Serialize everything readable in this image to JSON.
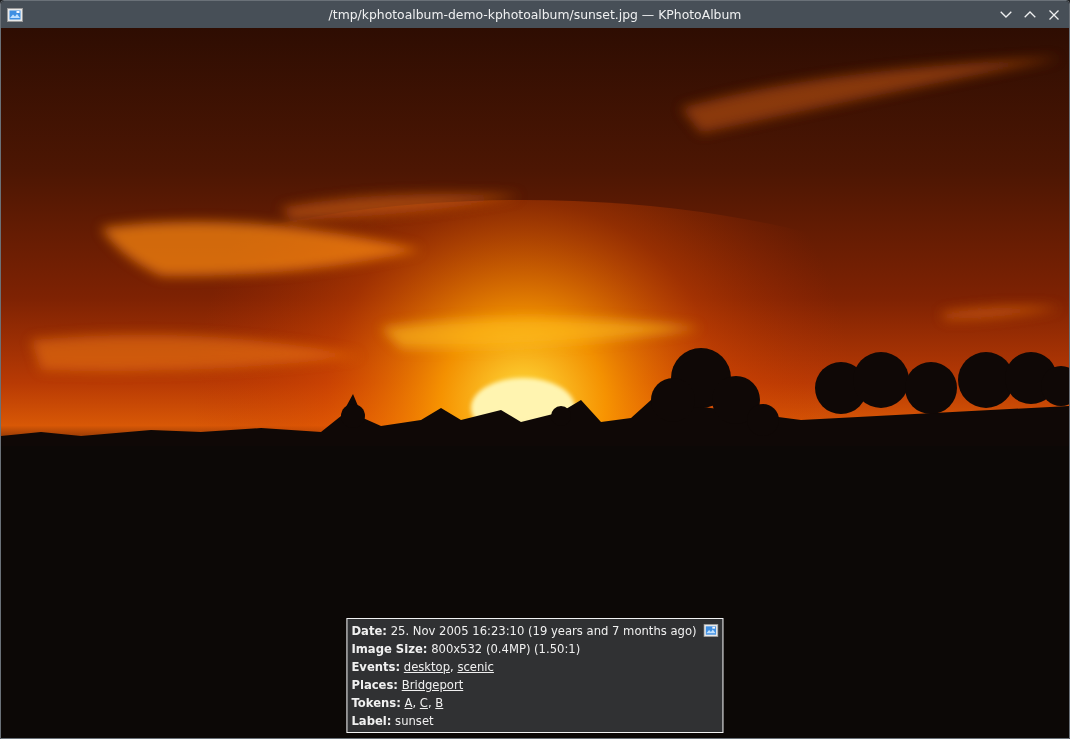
{
  "window": {
    "title": "/tmp/kphotoalbum-demo-kphotoalbum/sunset.jpg — KPhotoAlbum"
  },
  "info_box": {
    "rows": [
      {
        "kind": "text",
        "label": "Date:",
        "value": "25. Nov 2005 16:23:10 (19 years and 7 months ago)"
      },
      {
        "kind": "text",
        "label": "Image Size:",
        "value": "800x532 (0.4MP) (1.50:1)"
      },
      {
        "kind": "links",
        "label": "Events:",
        "separator": ", ",
        "links": [
          "desktop",
          "scenic"
        ]
      },
      {
        "kind": "links",
        "label": "Places:",
        "links": [
          "Bridgeport"
        ]
      },
      {
        "kind": "links",
        "label": "Tokens:",
        "separator": ", ",
        "links": [
          "A",
          "C",
          "B"
        ]
      },
      {
        "kind": "text",
        "label": "Label:",
        "value": "sunset"
      }
    ]
  }
}
